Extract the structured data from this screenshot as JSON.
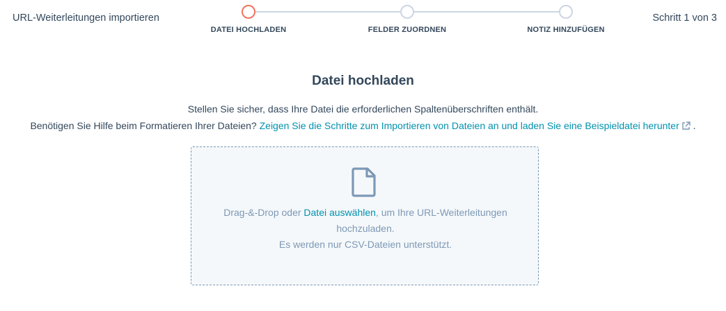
{
  "header": {
    "title": "URL-Weiterleitungen importieren",
    "step_counter": "Schritt 1 von 3",
    "steps": [
      {
        "label": "DATEI HOCHLADEN",
        "state": "active"
      },
      {
        "label": "FELDER ZUORDNEN",
        "state": "upcoming"
      },
      {
        "label": "NOTIZ HINZUFÜGEN",
        "state": "upcoming"
      }
    ]
  },
  "main": {
    "heading": "Datei hochladen",
    "line1": "Stellen Sie sicher, dass Ihre Datei die erforderlichen Spaltenüberschriften enthält.",
    "line2_prefix": "Benötigen Sie Hilfe beim Formatieren Ihrer Dateien? ",
    "line2_link": "Zeigen Sie die Schritte zum Importieren von Dateien an und laden Sie eine Beispieldatei herunter",
    "line2_suffix": " ."
  },
  "dropzone": {
    "icon": "file-icon",
    "text_prefix": "Drag-&-Drop oder ",
    "link": "Datei auswählen",
    "text_suffix": ", um Ihre URL-Weiterleitungen hochzuladen.",
    "note": "Es werden nur CSV-Dateien unterstützt."
  },
  "colors": {
    "active_step": "#f2735d",
    "inactive_step": "#cbd6e2",
    "link": "#0091ae",
    "text": "#33475b",
    "muted": "#7c98b6",
    "dropzone_bg": "#f5f8fa"
  }
}
